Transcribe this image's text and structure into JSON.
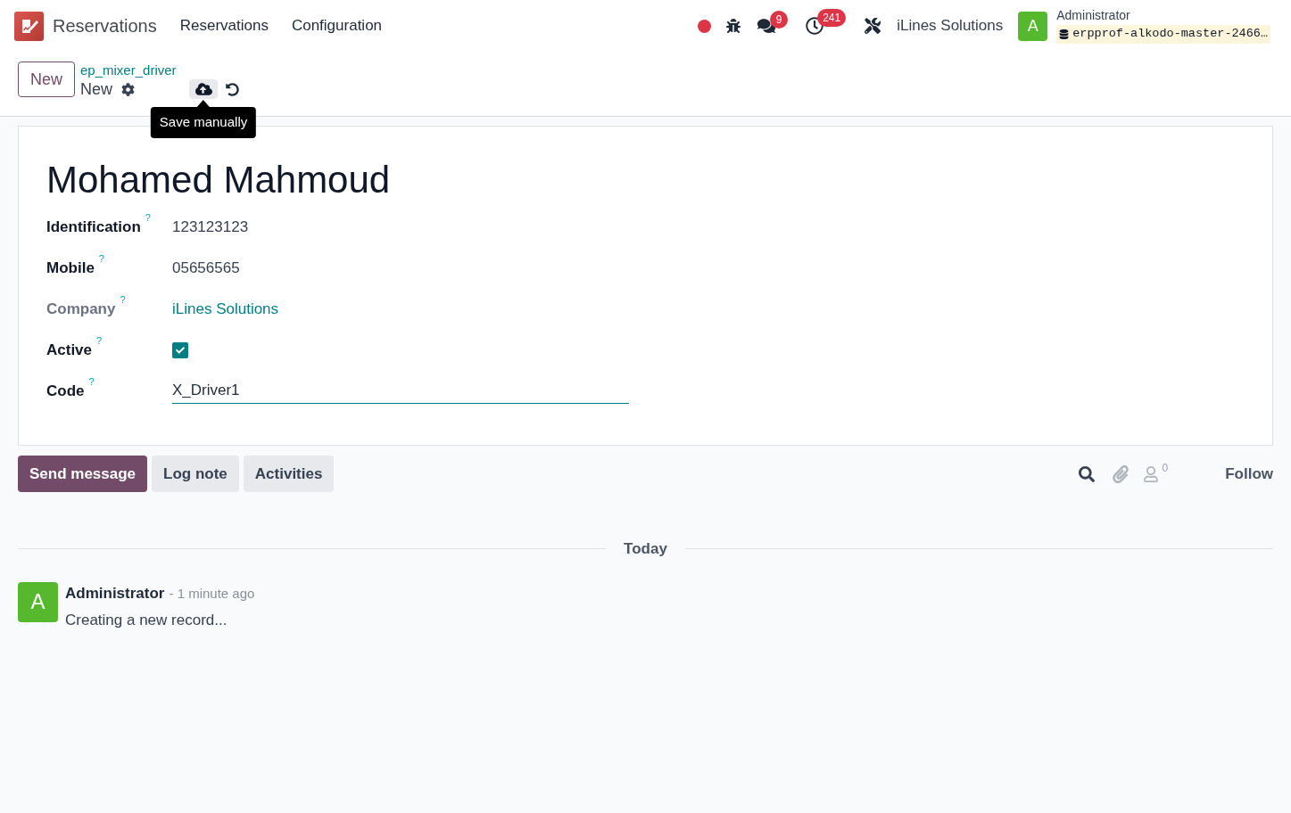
{
  "navbar": {
    "app_name": "Reservations",
    "menus": [
      {
        "label": "Reservations"
      },
      {
        "label": "Configuration"
      }
    ],
    "systray": {
      "messages_count": "9",
      "activities_count": "241",
      "company": "iLines Solutions",
      "user": {
        "avatar_letter": "A",
        "name": "Administrator",
        "database": "erpprof-alkodo-master-2466…"
      }
    }
  },
  "control_panel": {
    "new_button": "New",
    "breadcrumb": {
      "parent": "ep_mixer_driver",
      "current": "New"
    },
    "tooltip": "Save manually"
  },
  "form": {
    "title": "Mohamed Mahmoud",
    "fields": [
      {
        "label": "Identification",
        "help": "?",
        "kind": "text",
        "value": "123123123",
        "readonly": false
      },
      {
        "label": "Mobile",
        "help": "?",
        "kind": "text",
        "value": "05656565",
        "readonly": false
      },
      {
        "label": "Company",
        "help": "?",
        "kind": "link",
        "value": "iLines Solutions",
        "readonly": true
      },
      {
        "label": "Active",
        "help": "?",
        "kind": "checkbox",
        "checked": true,
        "readonly": false
      },
      {
        "label": "Code",
        "help": "?",
        "kind": "input",
        "value": "X_Driver1",
        "readonly": false
      }
    ]
  },
  "chatter": {
    "buttons": [
      {
        "label": "Send message",
        "kind": "primary"
      },
      {
        "label": "Log note",
        "kind": "secondary"
      },
      {
        "label": "Activities",
        "kind": "secondary"
      }
    ],
    "followers_count": "0",
    "follow_button": "Follow",
    "date_separator": "Today",
    "messages": [
      {
        "author": "Administrator",
        "avatar_letter": "A",
        "time": "- 1 minute ago",
        "body": "Creating a new record..."
      }
    ]
  }
}
